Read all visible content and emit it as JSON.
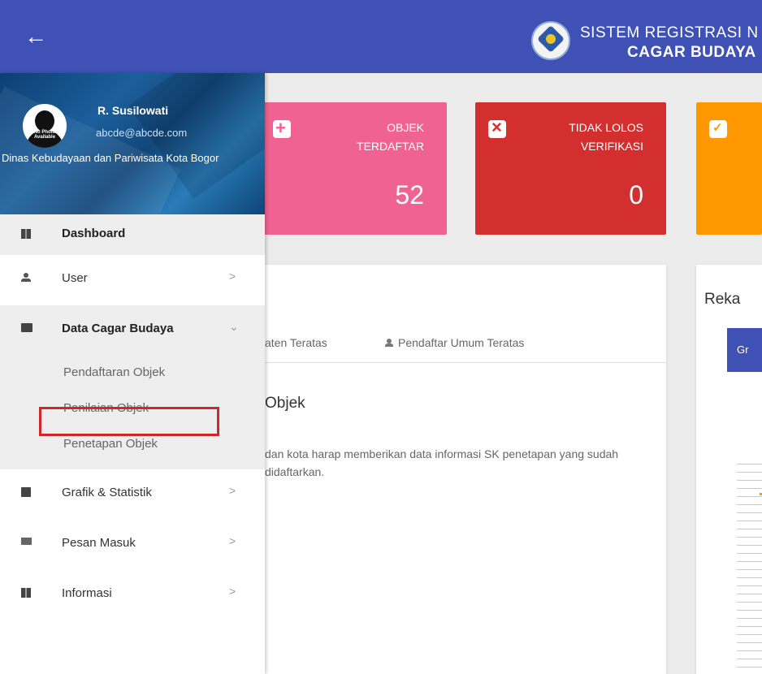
{
  "header": {
    "title_line1": "SISTEM REGISTRASI N",
    "title_line2": "CAGAR BUDAYA",
    "back_icon": "arrow-left-icon",
    "background": "#3f51b5"
  },
  "cards": [
    {
      "label_line1": "OBJEK",
      "label_line2": "TERDAFTAR",
      "value": "52",
      "icon": "plus-box-icon",
      "color": "#f06292"
    },
    {
      "label_line1": "TIDAK LOLOS",
      "label_line2": "VERIFIKASI",
      "value": "0",
      "icon": "close-circle-icon",
      "color": "#d32f2f"
    },
    {
      "icon": "clipboard-check-icon",
      "color": "#ff9800"
    }
  ],
  "main_panel": {
    "tab1": "aten Teratas",
    "tab2": "Pendaftar Umum Teratas",
    "section_title": "Objek",
    "description": "dan kota harap memberikan data informasi SK penetapan yang sudah didaftarkan."
  },
  "right_panel": {
    "title": "Reka",
    "button": "Gr"
  },
  "profile": {
    "name": "R. Susilowati",
    "email": "abcde@abcde.com",
    "organization": "Dinas Kebudayaan dan Pariwisata Kota Bogor",
    "avatar_text": "No Photo Available"
  },
  "menu": {
    "dashboard": "Dashboard",
    "user": "User",
    "data_cagar_budaya": "Data Cagar Budaya",
    "submenu": [
      "Pendaftaran Objek",
      "Penilaian Objek",
      "Penetapan Objek"
    ],
    "grafik": "Grafik & Statistik",
    "pesan": "Pesan Masuk",
    "informasi": "Informasi",
    "chevron_right": ">",
    "chevron_down": "⌄"
  },
  "highlight_color": "#d0272c"
}
